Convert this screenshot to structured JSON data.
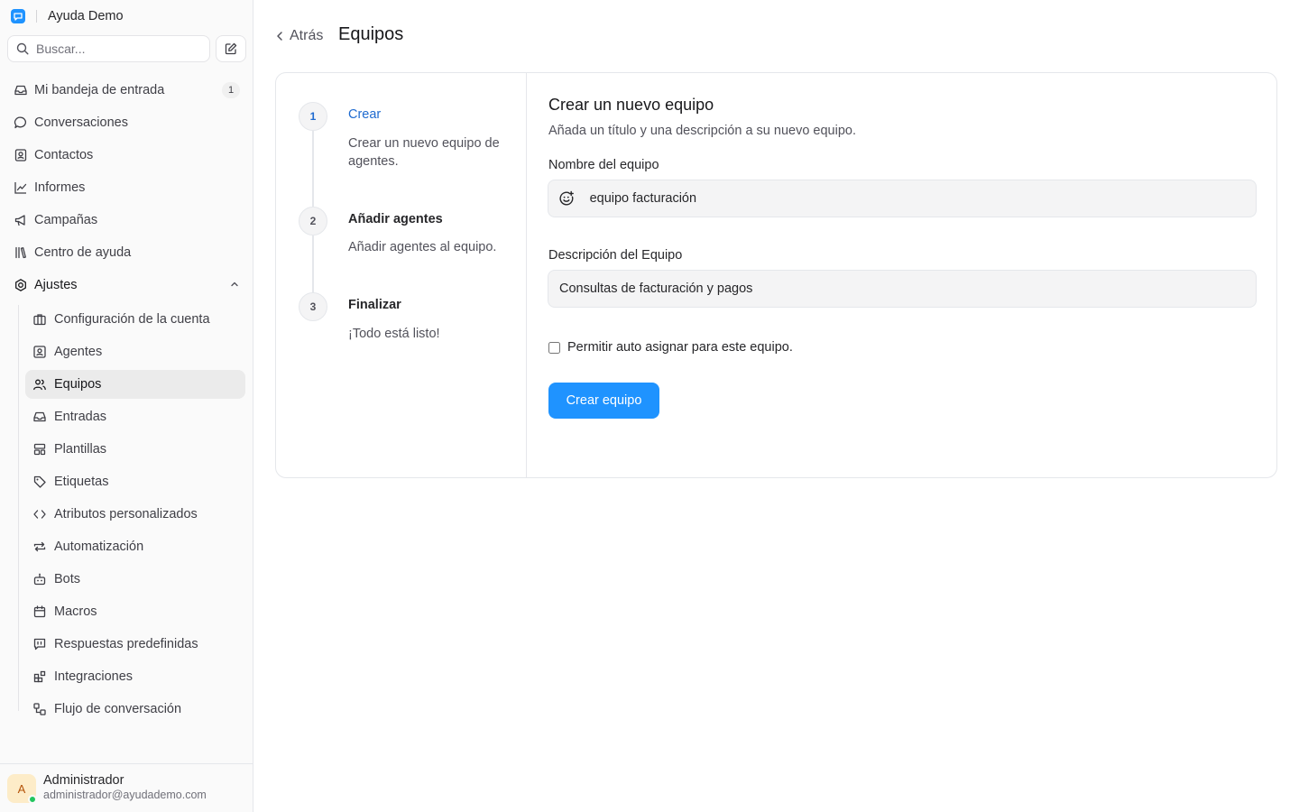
{
  "app": {
    "name": "Ayuda Demo"
  },
  "search": {
    "placeholder": "Buscar..."
  },
  "sidebar": {
    "items": [
      {
        "label": "Mi bandeja de entrada",
        "badge": "1"
      },
      {
        "label": "Conversaciones"
      },
      {
        "label": "Contactos"
      },
      {
        "label": "Informes"
      },
      {
        "label": "Campañas"
      },
      {
        "label": "Centro de ayuda"
      },
      {
        "label": "Ajustes"
      }
    ],
    "settings_items": [
      {
        "label": "Configuración de la cuenta"
      },
      {
        "label": "Agentes"
      },
      {
        "label": "Equipos",
        "active": true
      },
      {
        "label": "Entradas"
      },
      {
        "label": "Plantillas"
      },
      {
        "label": "Etiquetas"
      },
      {
        "label": "Atributos personalizados"
      },
      {
        "label": "Automatización"
      },
      {
        "label": "Bots"
      },
      {
        "label": "Macros"
      },
      {
        "label": "Respuestas predefinidas"
      },
      {
        "label": "Integraciones"
      },
      {
        "label": "Flujo de conversación"
      }
    ]
  },
  "profile": {
    "initial": "A",
    "name": "Administrador",
    "email": "administrador@ayudademo.com"
  },
  "header": {
    "back_label": "Atrás",
    "title": "Equipos"
  },
  "wizard": {
    "steps": [
      {
        "number": "1",
        "title": "Crear",
        "description": "Crear un nuevo equipo de agentes.",
        "active": true
      },
      {
        "number": "2",
        "title": "Añadir agentes",
        "description": "Añadir agentes al equipo."
      },
      {
        "number": "3",
        "title": "Finalizar",
        "description": "¡Todo está listo!"
      }
    ]
  },
  "form": {
    "title": "Crear un nuevo equipo",
    "subtitle": "Añada un título y una descripción a su nuevo equipo.",
    "name_label": "Nombre del equipo",
    "name_value": "equipo facturación",
    "description_label": "Descripción del Equipo",
    "description_value": "Consultas de facturación y pagos",
    "auto_assign_label": "Permitir auto asignar para este equipo.",
    "auto_assign_checked": false,
    "submit_label": "Crear equipo"
  },
  "colors": {
    "accent": "#1f93ff",
    "active_step": "#1f6bd0",
    "online": "#22c55e"
  }
}
